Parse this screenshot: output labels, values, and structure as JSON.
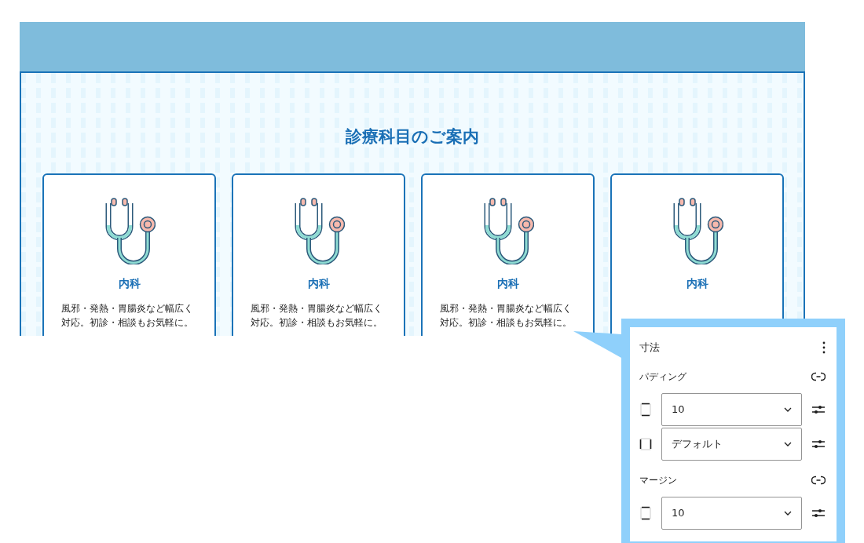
{
  "preview": {
    "heading": "診療科目のご案内",
    "cards": [
      {
        "title": "内科",
        "description": "風邪・発熱・胃腸炎など幅広く対応。初診・相談もお気軽に。"
      },
      {
        "title": "内科",
        "description": "風邪・発熱・胃腸炎など幅広く対応。初診・相談もお気軽に。"
      },
      {
        "title": "内科",
        "description": "風邪・発熱・胃腸炎など幅広く対応。初診・相談もお気軽に。"
      },
      {
        "title": "内科"
      }
    ]
  },
  "panel": {
    "title": "寸法",
    "groups": [
      {
        "label": "パディング",
        "rows": [
          {
            "kind": "vertical",
            "value": "10"
          },
          {
            "kind": "horizontal",
            "value": "デフォルト"
          }
        ]
      },
      {
        "label": "マージン",
        "rows": [
          {
            "kind": "vertical",
            "value": "10"
          }
        ]
      }
    ]
  }
}
